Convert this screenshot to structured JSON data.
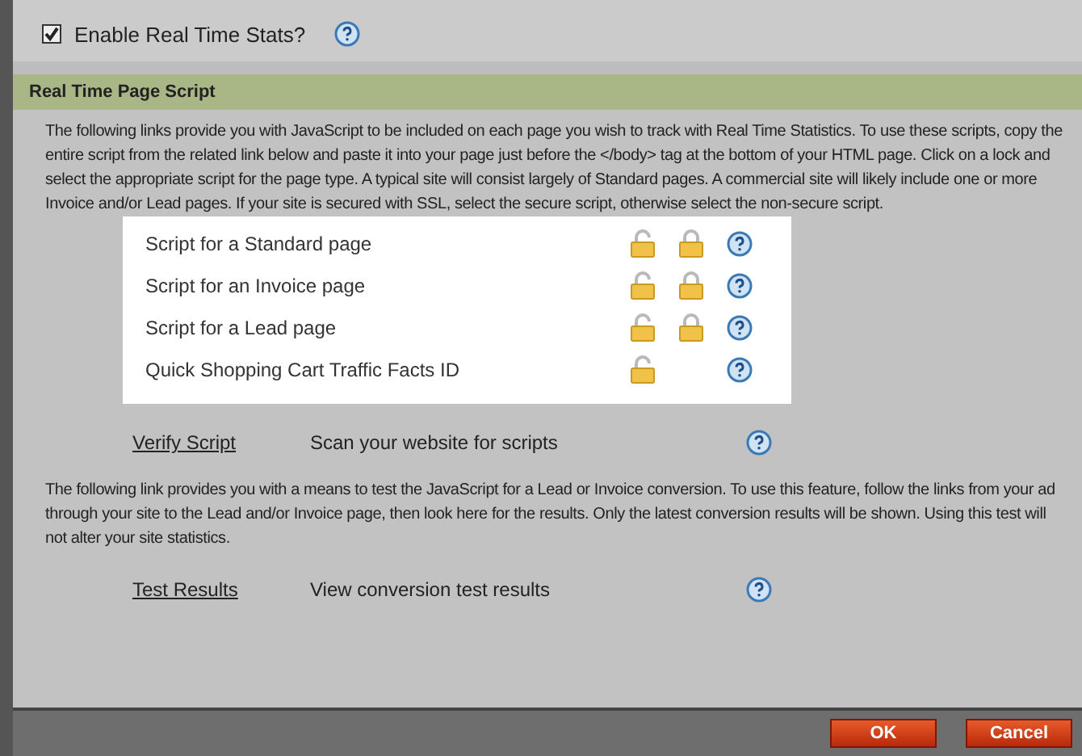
{
  "enable": {
    "label": "Enable Real Time Stats?",
    "checked": true
  },
  "section": {
    "title": "Real Time Page Script"
  },
  "intro": "The following links provide you with JavaScript to be included on each page you wish to track with Real Time Statistics. To use these scripts, copy the entire script from the related link below and paste it into your page just before the </body> tag at the bottom of your HTML page. Click on a lock and select the appropriate script for the page type. A typical site will consist largely of Standard pages. A commercial site will likely include one or more Invoice and/or Lead pages. If your site is secured with SSL, select the secure script, otherwise select the non-secure script.",
  "scripts": [
    {
      "label": "Script for a Standard page",
      "secure_lock": true
    },
    {
      "label": "Script for an Invoice page",
      "secure_lock": true
    },
    {
      "label": "Script for a Lead page",
      "secure_lock": true
    },
    {
      "label": "Quick Shopping Cart Traffic Facts ID",
      "secure_lock": false
    }
  ],
  "verify": {
    "link": "Verify Script",
    "description": "Scan your website for scripts"
  },
  "test_intro": "The following link provides you with a means to test the JavaScript for a Lead or Invoice conversion. To use this feature, follow the links from your ad through your site to the Lead and/or Invoice page, then look here for the results. Only the latest conversion results will be shown. Using this test will not alter your site statistics.",
  "test": {
    "link": "Test Results",
    "description": "View conversion test results"
  },
  "buttons": [
    "OK",
    "Cancel"
  ]
}
